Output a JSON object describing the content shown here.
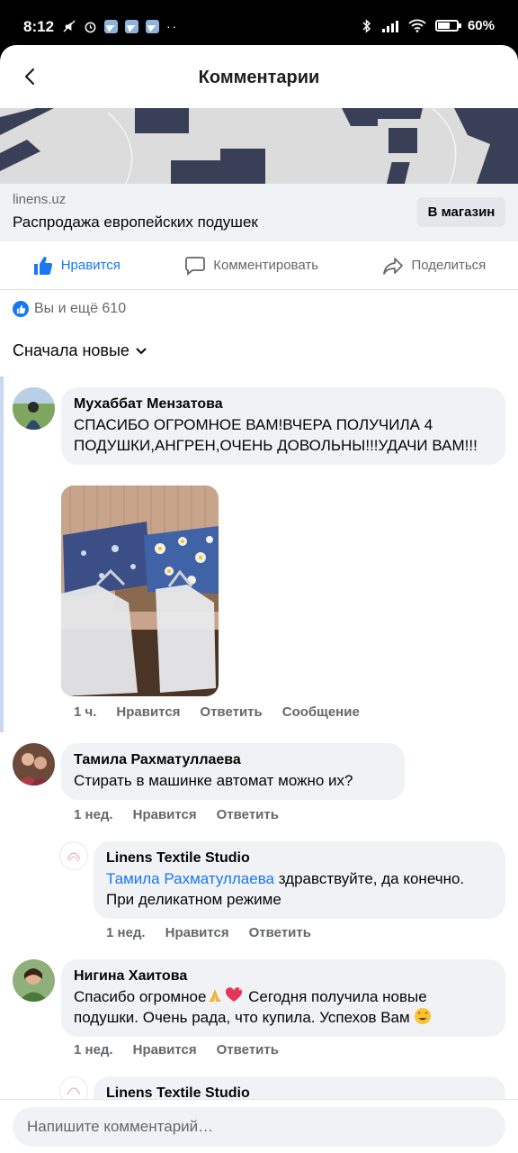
{
  "status": {
    "time": "8:12",
    "battery": "60%"
  },
  "header": {
    "title": "Комментарии"
  },
  "link": {
    "domain": "linens.uz",
    "title": "Распродажа европейских подушек",
    "shop_button": "В магазин"
  },
  "actions": {
    "like": "Нравится",
    "comment": "Комментировать",
    "share": "Поделиться"
  },
  "reactions": {
    "summary": "Вы и ещё 610"
  },
  "sort": {
    "label": "Сначала новые"
  },
  "comments": [
    {
      "author": "Мухаббат Мензатова",
      "text": "СПАСИБО ОГРОМНОЕ ВАМ!ВЧЕРА ПОЛУЧИЛА 4 ПОДУШКИ,АНГРЕН,ОЧЕНЬ ДОВОЛЬНЫ!!!УДАЧИ ВАМ!!!",
      "time": "1 ч.",
      "like": "Нравится",
      "reply": "Ответить",
      "message": "Сообщение"
    },
    {
      "author": "Тамила Рахматуллаева",
      "text": "Стирать в машинке автомат можно их?",
      "time": "1 нед.",
      "like": "Нравится",
      "reply": "Ответить"
    },
    {
      "author": "Linens Textile Studio",
      "mention": "Тамила Рахматуллаева",
      "text": " здравствуйте, да конечно. При деликатном режиме",
      "time": "1 нед.",
      "like": "Нравится",
      "reply": "Ответить"
    },
    {
      "author": "Нигина Хаитова",
      "text_a": "Спасибо огромное",
      "text_b": " Сегодня получила новые подушки. Очень рада, что купила. Успехов Вам ",
      "time": "1 нед.",
      "like": "Нравится",
      "reply": "Ответить"
    },
    {
      "author": "Linens Textile Studio"
    }
  ],
  "input": {
    "placeholder": "Напишите комментарий…"
  },
  "colors": {
    "accent": "#1877f2",
    "bubble": "#f0f2f5",
    "secondary_text": "#65676b"
  }
}
